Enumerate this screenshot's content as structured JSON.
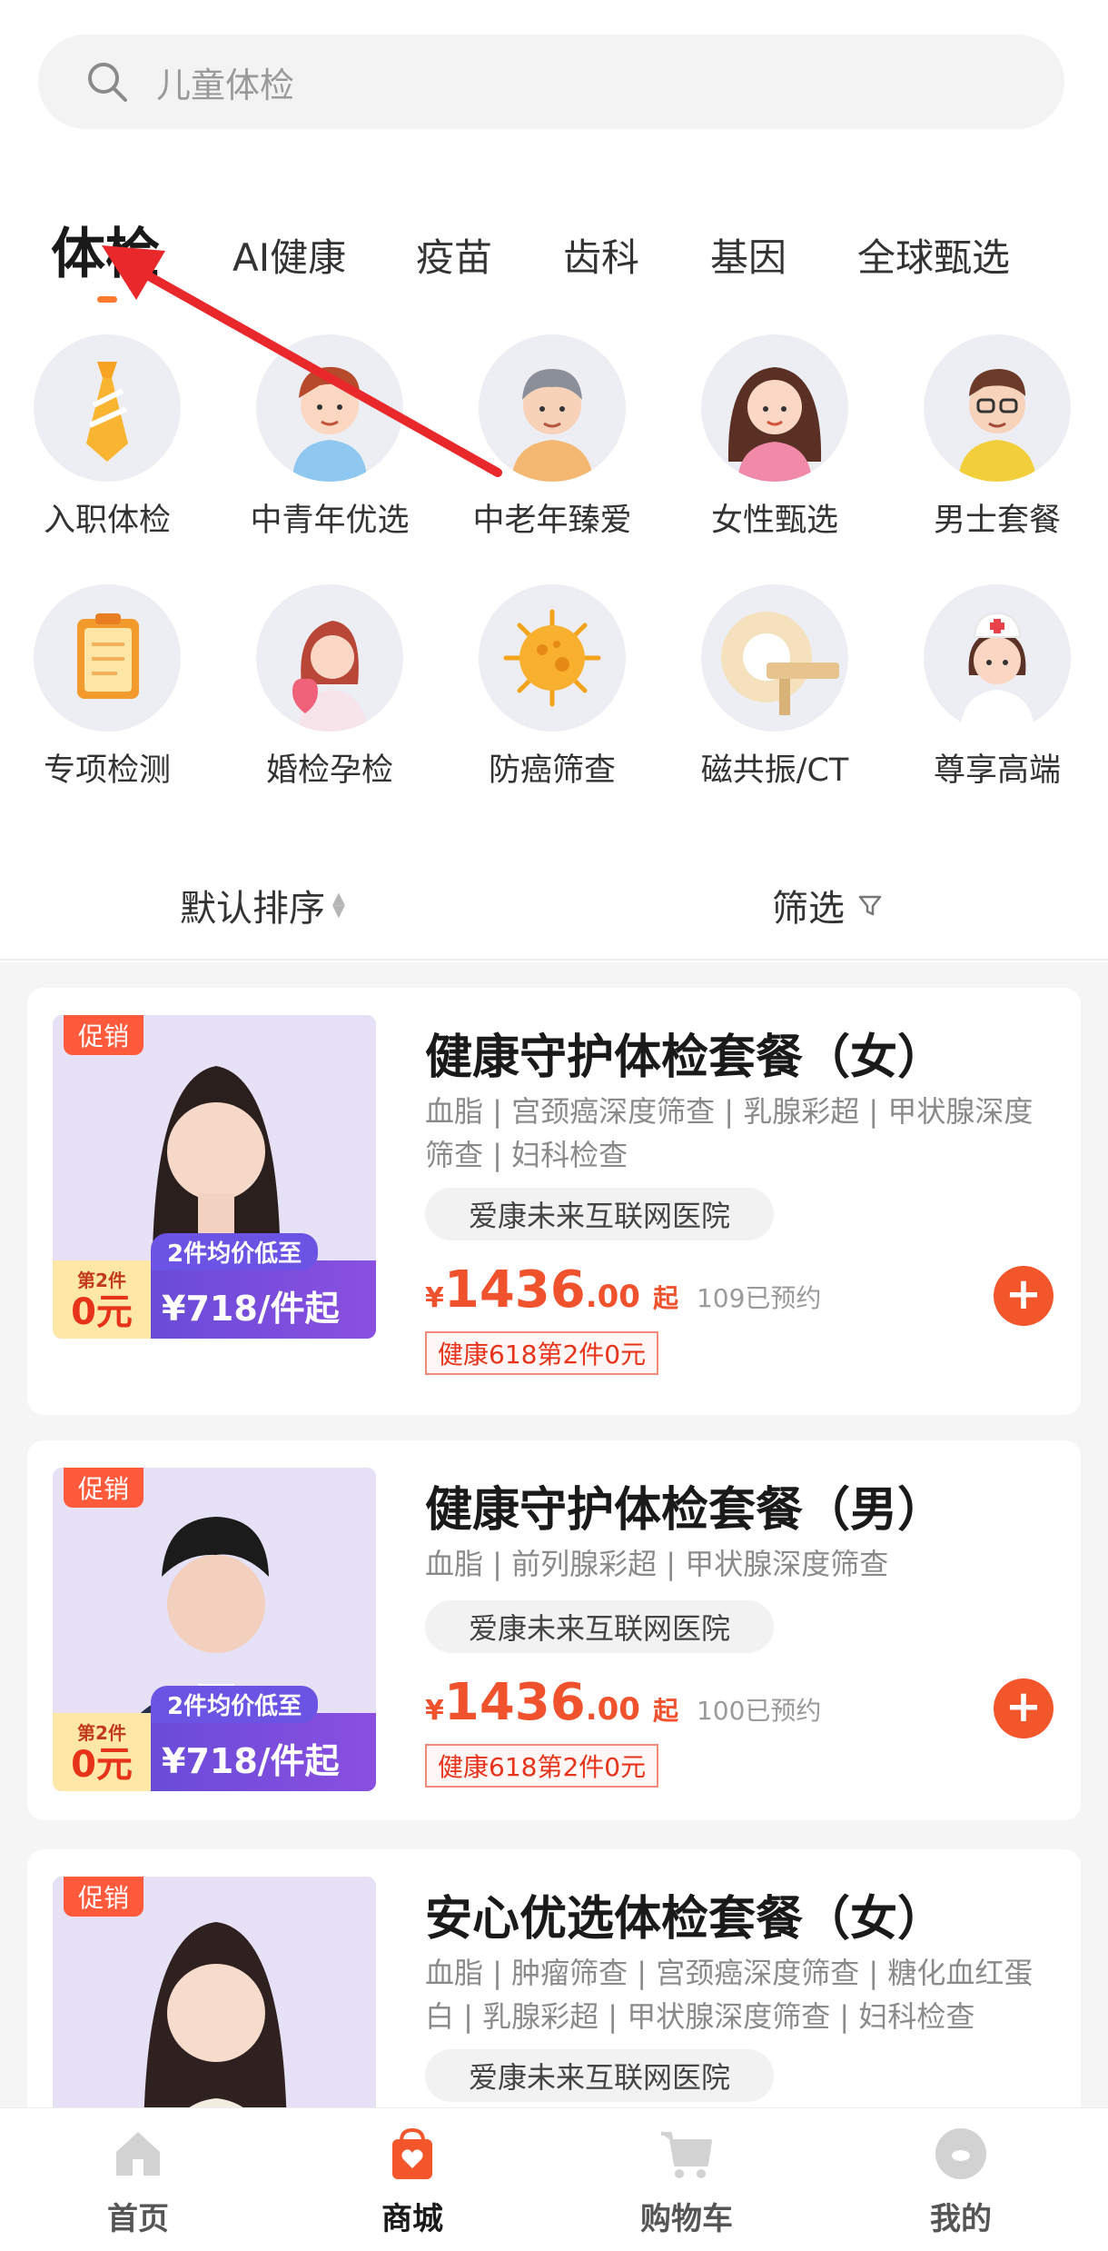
{
  "search": {
    "placeholder": "儿童体检"
  },
  "category_tabs": [
    {
      "label": "体检",
      "active": true
    },
    {
      "label": "AI健康"
    },
    {
      "label": "疫苗"
    },
    {
      "label": "齿科"
    },
    {
      "label": "基因"
    },
    {
      "label": "全球甄选"
    }
  ],
  "packages": [
    {
      "label": "入职体检",
      "icon": "tie-icon"
    },
    {
      "label": "中青年优选",
      "icon": "young-man-icon"
    },
    {
      "label": "中老年臻爱",
      "icon": "elderly-man-icon"
    },
    {
      "label": "女性甄选",
      "icon": "woman-icon"
    },
    {
      "label": "男士套餐",
      "icon": "man-glasses-icon"
    },
    {
      "label": "专项检测",
      "icon": "clipboard-icon"
    },
    {
      "label": "婚检孕检",
      "icon": "bride-icon"
    },
    {
      "label": "防癌筛查",
      "icon": "cancer-cell-icon"
    },
    {
      "label": "磁共振/CT",
      "icon": "mri-scanner-icon"
    },
    {
      "label": "尊享高端",
      "icon": "nurse-icon"
    }
  ],
  "sort": {
    "default_label": "默认排序",
    "filter_label": "筛选"
  },
  "products": [
    {
      "promo": "促销",
      "deal_small": "第2件",
      "deal_big": "0元",
      "deal_note": "2件均价低至",
      "deal_price": "¥718/件起",
      "title": "健康守护体检套餐（女）",
      "items": "血脂 | 宫颈癌深度筛查 | 乳腺彩超 | 甲状腺深度筛查 | 妇科检查",
      "hospital": "爱康未来互联网医院",
      "price_yen": "¥",
      "price_int": "1436",
      "price_dec": ".00",
      "price_from": "起",
      "booked": "109已预约",
      "coupon": "健康618第2件0元"
    },
    {
      "promo": "促销",
      "deal_small": "第2件",
      "deal_big": "0元",
      "deal_note": "2件均价低至",
      "deal_price": "¥718/件起",
      "title": "健康守护体检套餐（男）",
      "items": "血脂 | 前列腺彩超 | 甲状腺深度筛查",
      "hospital": "爱康未来互联网医院",
      "price_yen": "¥",
      "price_int": "1436",
      "price_dec": ".00",
      "price_from": "起",
      "booked": "100已预约",
      "coupon": "健康618第2件0元"
    },
    {
      "promo": "促销",
      "title": "安心优选体检套餐（女）",
      "items": "血脂 | 肿瘤筛查 | 宫颈癌深度筛查 | 糖化血红蛋白 | 乳腺彩超 | 甲状腺深度筛查 | 妇科检查",
      "hospital": "爱康未来互联网医院"
    }
  ],
  "bottom_nav": [
    {
      "label": "首页",
      "icon": "home-icon"
    },
    {
      "label": "商城",
      "icon": "shopping-bag-icon",
      "active": true
    },
    {
      "label": "购物车",
      "icon": "cart-icon"
    },
    {
      "label": "我的",
      "icon": "profile-icon"
    }
  ],
  "colors": {
    "accent": "#f4562c",
    "tab_indicator": "#ff7a2f",
    "annotation_arrow": "#e8282b"
  }
}
